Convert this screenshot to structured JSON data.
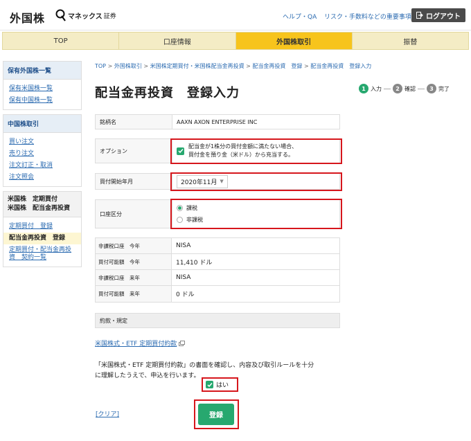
{
  "header": {
    "site_title": "外国株",
    "brand_name": "マネックス",
    "brand_suffix": "証券",
    "help": "ヘルプ・QA",
    "risk": "リスク・手数料などの重要事項",
    "logout": "ログアウト"
  },
  "nav": {
    "items": [
      {
        "label": "TOP"
      },
      {
        "label": "口座情報"
      },
      {
        "label": "外国株取引"
      },
      {
        "label": "振替"
      }
    ],
    "active": "外国株取引"
  },
  "sidebar": {
    "holdings_title": "保有外国株一覧",
    "holdings_links": [
      "保有米国株一覧",
      "保有中国株一覧"
    ],
    "china_title": "中国株取引",
    "china_links": [
      "買い注文",
      "売り注文",
      "注文訂正・取消",
      "注文照会"
    ],
    "us_title_1": "米国株　定期買付",
    "us_title_2": "米国株　配当金再投資",
    "us_links": [
      "定期買付　登録",
      "配当金再投資　登録",
      "定期買付・配当金再投資　契約一覧"
    ]
  },
  "breadcrumb": {
    "items": [
      "TOP",
      "外国株取引",
      "米国株定期買付・米国株配当金再投資",
      "配当金再投資　登録",
      "配当金再投資　登録入力"
    ]
  },
  "page_title": "配当金再投資　登録入力",
  "steps": [
    {
      "num": "1",
      "label": "入力"
    },
    {
      "num": "2",
      "label": "確認"
    },
    {
      "num": "3",
      "label": "完了"
    }
  ],
  "form": {
    "brand_label": "銘柄名",
    "brand_value": "AAXN AXON ENTERPRISE INC",
    "option_label": "オプション",
    "option_text_1": "配当金が1株分の買付金額に満たない場合、",
    "option_text_2": "買付金を預り金（米ドル）から充当する。",
    "start_label": "買付開始年月",
    "start_value": "2020年11月",
    "account_label": "口座区分",
    "account_options": [
      "課税",
      "非課税"
    ]
  },
  "info": {
    "rows": [
      {
        "label": "非課税口座　今年",
        "value": "NISA"
      },
      {
        "label": "買付可能額　今年",
        "value": "11,410 ドル"
      },
      {
        "label": "非課税口座　来年",
        "value": "NISA"
      },
      {
        "label": "買付可能額　来年",
        "value": "0 ドル"
      }
    ]
  },
  "terms": {
    "bar_label": "約款・規定",
    "link": "米国株式・ETF 定期買付約款",
    "notice_1": "「米国株式・ETF 定期買付約款」の書面を確認し、内容及び取引ルールを十分",
    "notice_2": "に理解したうえで、申込を行います。",
    "agree": "はい"
  },
  "actions": {
    "clear": "[クリア]",
    "submit": "登録"
  }
}
